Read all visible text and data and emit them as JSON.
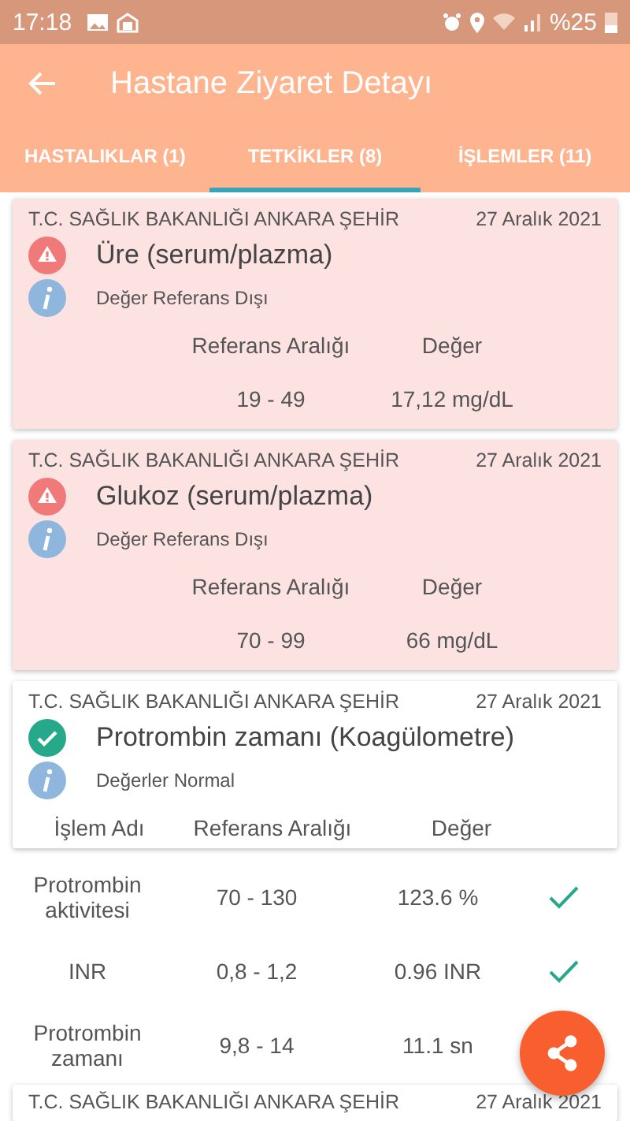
{
  "status_bar": {
    "time": "17:18",
    "battery": "%25"
  },
  "app_bar": {
    "title": "Hastane Ziyaret Detayı"
  },
  "tabs": [
    {
      "label": "HASTALIKLAR (1)",
      "selected": false
    },
    {
      "label": "TETKİKLER (8)",
      "selected": true
    },
    {
      "label": "İŞLEMLER (11)",
      "selected": false
    }
  ],
  "cards": [
    {
      "hospital": "T.C. SAĞLIK BAKANLIĞI ANKARA ŞEHİR",
      "date": "27 Aralık 2021",
      "kind": "abnormal",
      "test": "Üre (serum/plazma)",
      "note": "Değer Referans Dışı",
      "columns": [
        "Referans Aralığı",
        "Değer"
      ],
      "rows": [
        {
          "range": "19 - 49",
          "value": "17,12 mg/dL"
        }
      ]
    },
    {
      "hospital": "T.C. SAĞLIK BAKANLIĞI ANKARA ŞEHİR",
      "date": "27 Aralık 2021",
      "kind": "abnormal",
      "test": "Glukoz (serum/plazma)",
      "note": "Değer Referans Dışı",
      "columns": [
        "Referans Aralığı",
        "Değer"
      ],
      "rows": [
        {
          "range": "70 - 99",
          "value": "66 mg/dL"
        }
      ]
    },
    {
      "hospital": "T.C. SAĞLIK BAKANLIĞI ANKARA ŞEHİR",
      "date": "27 Aralık 2021",
      "kind": "normal",
      "test": "Protrombin zamanı (Koagülometre)",
      "note": "Değerler Normal",
      "columns": [
        "İşlem Adı",
        "Referans Aralığı",
        "Değer"
      ],
      "rows": [
        {
          "name": "Protrombin aktivitesi",
          "range": "70 - 130",
          "value": "123.6 %",
          "ok": true
        },
        {
          "name": "INR",
          "range": "0,8 - 1,2",
          "value": "0.96 INR",
          "ok": true
        },
        {
          "name": "Protrombin zamanı",
          "range": "9,8 - 14",
          "value": "11.1 sn"
        }
      ]
    },
    {
      "hospital": "T.C. SAĞLIK BAKANLIĞI ANKARA ŞEHİR",
      "date": "27 Aralık 2021",
      "kind": "partial"
    }
  ]
}
